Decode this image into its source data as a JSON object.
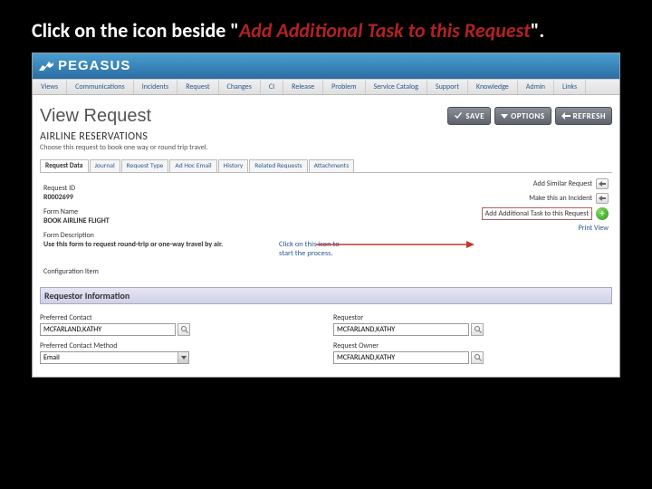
{
  "instruction": {
    "pre": "Click on the icon beside \"",
    "highlight": "Add Additional Task to this Request",
    "post": "\"."
  },
  "brand": "PEGASUS",
  "menubar": [
    "Views",
    "Communications",
    "Incidents",
    "Request",
    "Changes",
    "CI",
    "Release",
    "Problem",
    "Service Catalog",
    "Support",
    "Knowledge",
    "Admin",
    "Links"
  ],
  "page_title": "View Request",
  "buttons": {
    "save": "SAVE",
    "options": "OPTIONS",
    "refresh": "REFRESH"
  },
  "section": {
    "title": "AIRLINE RESERVATIONS",
    "desc": "Choose this request to book one way or round trip travel."
  },
  "tabs": [
    "Request Data",
    "Journal",
    "Request Type",
    "Ad Hoc Email",
    "History",
    "Related Requests",
    "Attachments"
  ],
  "left": {
    "req_id_lbl": "Request ID",
    "req_id_val": "R0002699",
    "form_name_lbl": "Form Name",
    "form_name_val": "BOOK AIRLINE FLIGHT",
    "form_desc_lbl": "Form Description",
    "form_desc_val": "Use this form to request round-trip or one-way travel by air.",
    "ci_lbl": "Configuration Item"
  },
  "right": {
    "add_similar": "Add Similar Request",
    "make_incident": "Make this an Incident",
    "add_task": "Add Additional Task to this Request",
    "print_view": "Print View"
  },
  "callout": "Click on this icon to start the process.",
  "requestor_bar": "Requestor Information",
  "fields": {
    "pref_contact_lbl": "Preferred Contact",
    "pref_contact_val": "MCFARLAND,KATHY",
    "pref_method_lbl": "Preferred Contact Method",
    "pref_method_val": "Email",
    "requestor_lbl": "Requestor",
    "requestor_val": "MCFARLAND,KATHY",
    "owner_lbl": "Request Owner",
    "owner_val": "MCFARLAND,KATHY"
  }
}
